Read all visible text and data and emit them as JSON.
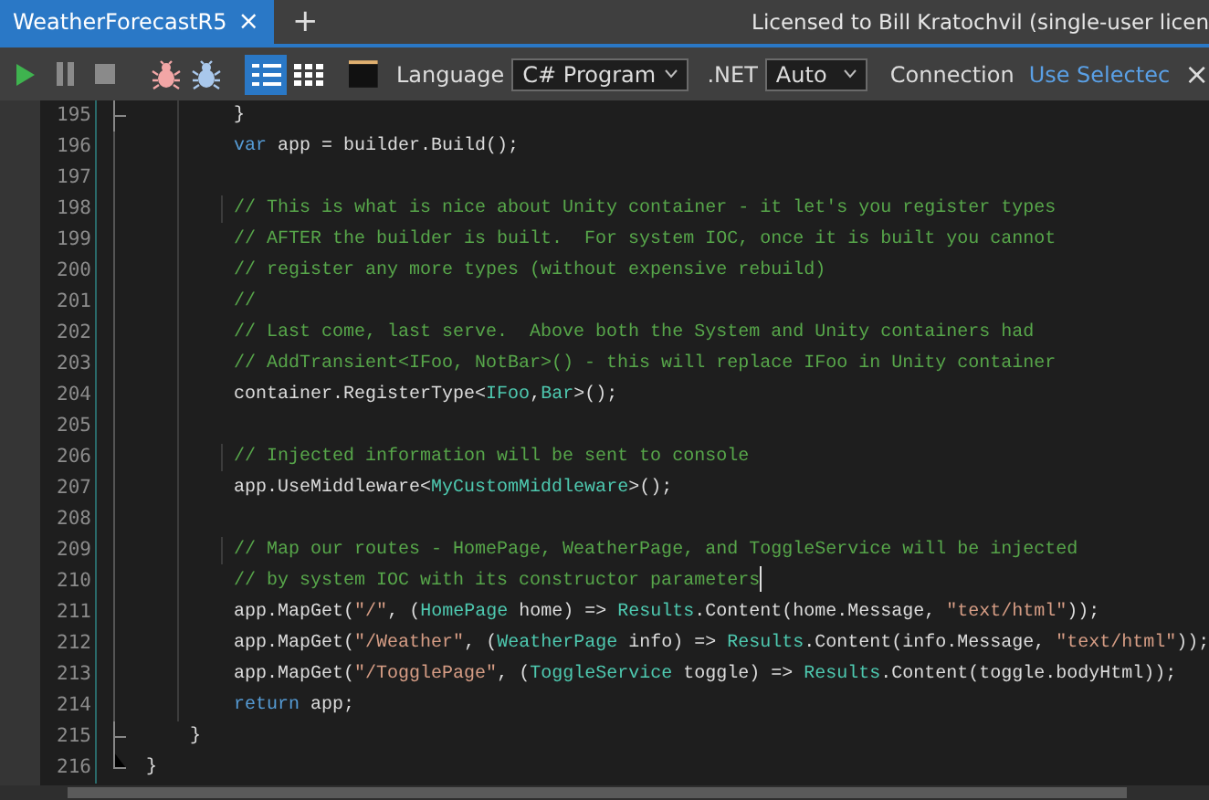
{
  "tabs": [
    {
      "label": "WeatherForecastR5",
      "selected": true,
      "close": "×"
    }
  ],
  "new_tab": "+",
  "license": "Licensed to Bill Kratochvil (single-user licen",
  "toolbar": {
    "actions": [
      {
        "kind": "run",
        "disabled": false
      },
      {
        "kind": "pause",
        "disabled": true
      },
      {
        "kind": "stop",
        "disabled": true
      },
      {
        "kind": "debug",
        "disabled": false
      },
      {
        "kind": "debug-step",
        "disabled": false
      }
    ],
    "view_modes": [
      {
        "kind": "list",
        "selected": true
      },
      {
        "kind": "grid",
        "selected": false
      }
    ],
    "language": {
      "label": "Language",
      "value": "C# Program"
    },
    "framework": {
      "label": ".NET",
      "value": "Auto"
    },
    "connection": {
      "label": "Connection",
      "link": "Use Selectec",
      "close": "×"
    }
  },
  "editor": {
    "lines": [
      {
        "number": "195",
        "fold_end": true,
        "caret": false,
        "tokens": [
          {
            "kind": "plain",
            "text": "        }"
          }
        ]
      },
      {
        "number": "196",
        "caret": false,
        "tokens": [
          {
            "kind": "keyword",
            "text": "        var"
          },
          {
            "kind": "plain",
            "text": " app = builder.Build();"
          }
        ]
      },
      {
        "number": "197",
        "caret": false
      },
      {
        "number": "198",
        "caret": false,
        "tokens": [
          {
            "kind": "comment",
            "text": "        // This is what is nice about Unity container - it let's you register types"
          }
        ]
      },
      {
        "number": "199",
        "caret": false,
        "tokens": [
          {
            "kind": "comment",
            "text": "        // AFTER the builder is built.  For system IOC, once it is built you cannot"
          }
        ]
      },
      {
        "number": "200",
        "caret": false,
        "tokens": [
          {
            "kind": "comment",
            "text": "        // register any more types (without expensive rebuild)"
          }
        ]
      },
      {
        "number": "201",
        "caret": false,
        "tokens": [
          {
            "kind": "comment",
            "text": "        //"
          }
        ]
      },
      {
        "number": "202",
        "caret": false,
        "tokens": [
          {
            "kind": "comment",
            "text": "        // Last come, last serve.  Above both the System and Unity containers had"
          }
        ]
      },
      {
        "number": "203",
        "caret": false,
        "tokens": [
          {
            "kind": "comment",
            "text": "        // AddTransient<IFoo, NotBar>() - this will replace IFoo in Unity container"
          }
        ]
      },
      {
        "number": "204",
        "caret": false,
        "tokens": [
          {
            "kind": "plain",
            "text": "        container.RegisterType<"
          },
          {
            "kind": "type",
            "text": "IFoo"
          },
          {
            "kind": "plain",
            "text": ","
          },
          {
            "kind": "type",
            "text": "Bar"
          },
          {
            "kind": "plain",
            "text": ">();"
          }
        ]
      },
      {
        "number": "205",
        "caret": false
      },
      {
        "number": "206",
        "caret": false,
        "tokens": [
          {
            "kind": "comment",
            "text": "        // Injected information will be sent to console"
          }
        ]
      },
      {
        "number": "207",
        "caret": false,
        "tokens": [
          {
            "kind": "plain",
            "text": "        app.UseMiddleware<"
          },
          {
            "kind": "type",
            "text": "MyCustomMiddleware"
          },
          {
            "kind": "plain",
            "text": ">();"
          }
        ]
      },
      {
        "number": "208",
        "caret": false
      },
      {
        "number": "209",
        "caret": false,
        "tokens": [
          {
            "kind": "comment",
            "text": "        // Map our routes - HomePage, WeatherPage, and ToggleService will be injected"
          }
        ]
      },
      {
        "number": "210",
        "caret": true,
        "tokens": [
          {
            "kind": "comment",
            "text": "        // by system IOC with its constructor parameters"
          }
        ]
      },
      {
        "number": "211",
        "caret": false,
        "tokens": [
          {
            "kind": "plain",
            "text": "        app.MapGet("
          },
          {
            "kind": "string",
            "text": "\"/\""
          },
          {
            "kind": "plain",
            "text": ", ("
          },
          {
            "kind": "type",
            "text": "HomePage"
          },
          {
            "kind": "plain",
            "text": " home) => "
          },
          {
            "kind": "type",
            "text": "Results"
          },
          {
            "kind": "plain",
            "text": ".Content(home.Message, "
          },
          {
            "kind": "string",
            "text": "\"text/html\""
          },
          {
            "kind": "plain",
            "text": "));"
          }
        ]
      },
      {
        "number": "212",
        "caret": false,
        "tokens": [
          {
            "kind": "plain",
            "text": "        app.MapGet("
          },
          {
            "kind": "string",
            "text": "\"/Weather\""
          },
          {
            "kind": "plain",
            "text": ", ("
          },
          {
            "kind": "type",
            "text": "WeatherPage"
          },
          {
            "kind": "plain",
            "text": " info) => "
          },
          {
            "kind": "type",
            "text": "Results"
          },
          {
            "kind": "plain",
            "text": ".Content(info.Message, "
          },
          {
            "kind": "string",
            "text": "\"text/html\""
          },
          {
            "kind": "plain",
            "text": "));"
          }
        ]
      },
      {
        "number": "213",
        "caret": false,
        "tokens": [
          {
            "kind": "plain",
            "text": "        app.MapGet("
          },
          {
            "kind": "string",
            "text": "\"/TogglePage\""
          },
          {
            "kind": "plain",
            "text": ", ("
          },
          {
            "kind": "type",
            "text": "ToggleService"
          },
          {
            "kind": "plain",
            "text": " toggle) => "
          },
          {
            "kind": "type",
            "text": "Results"
          },
          {
            "kind": "plain",
            "text": ".Content(toggle.bodyHtml));"
          }
        ]
      },
      {
        "number": "214",
        "caret": false,
        "tokens": [
          {
            "kind": "keyword",
            "text": "        return"
          },
          {
            "kind": "plain",
            "text": " app;"
          }
        ]
      },
      {
        "number": "215",
        "fold_end": true,
        "caret": false,
        "tokens": [
          {
            "kind": "plain",
            "text": "    }"
          }
        ]
      },
      {
        "number": "216",
        "fold_end": true,
        "caret": false,
        "tokens": [
          {
            "kind": "plain",
            "text": "}"
          }
        ]
      }
    ]
  }
}
